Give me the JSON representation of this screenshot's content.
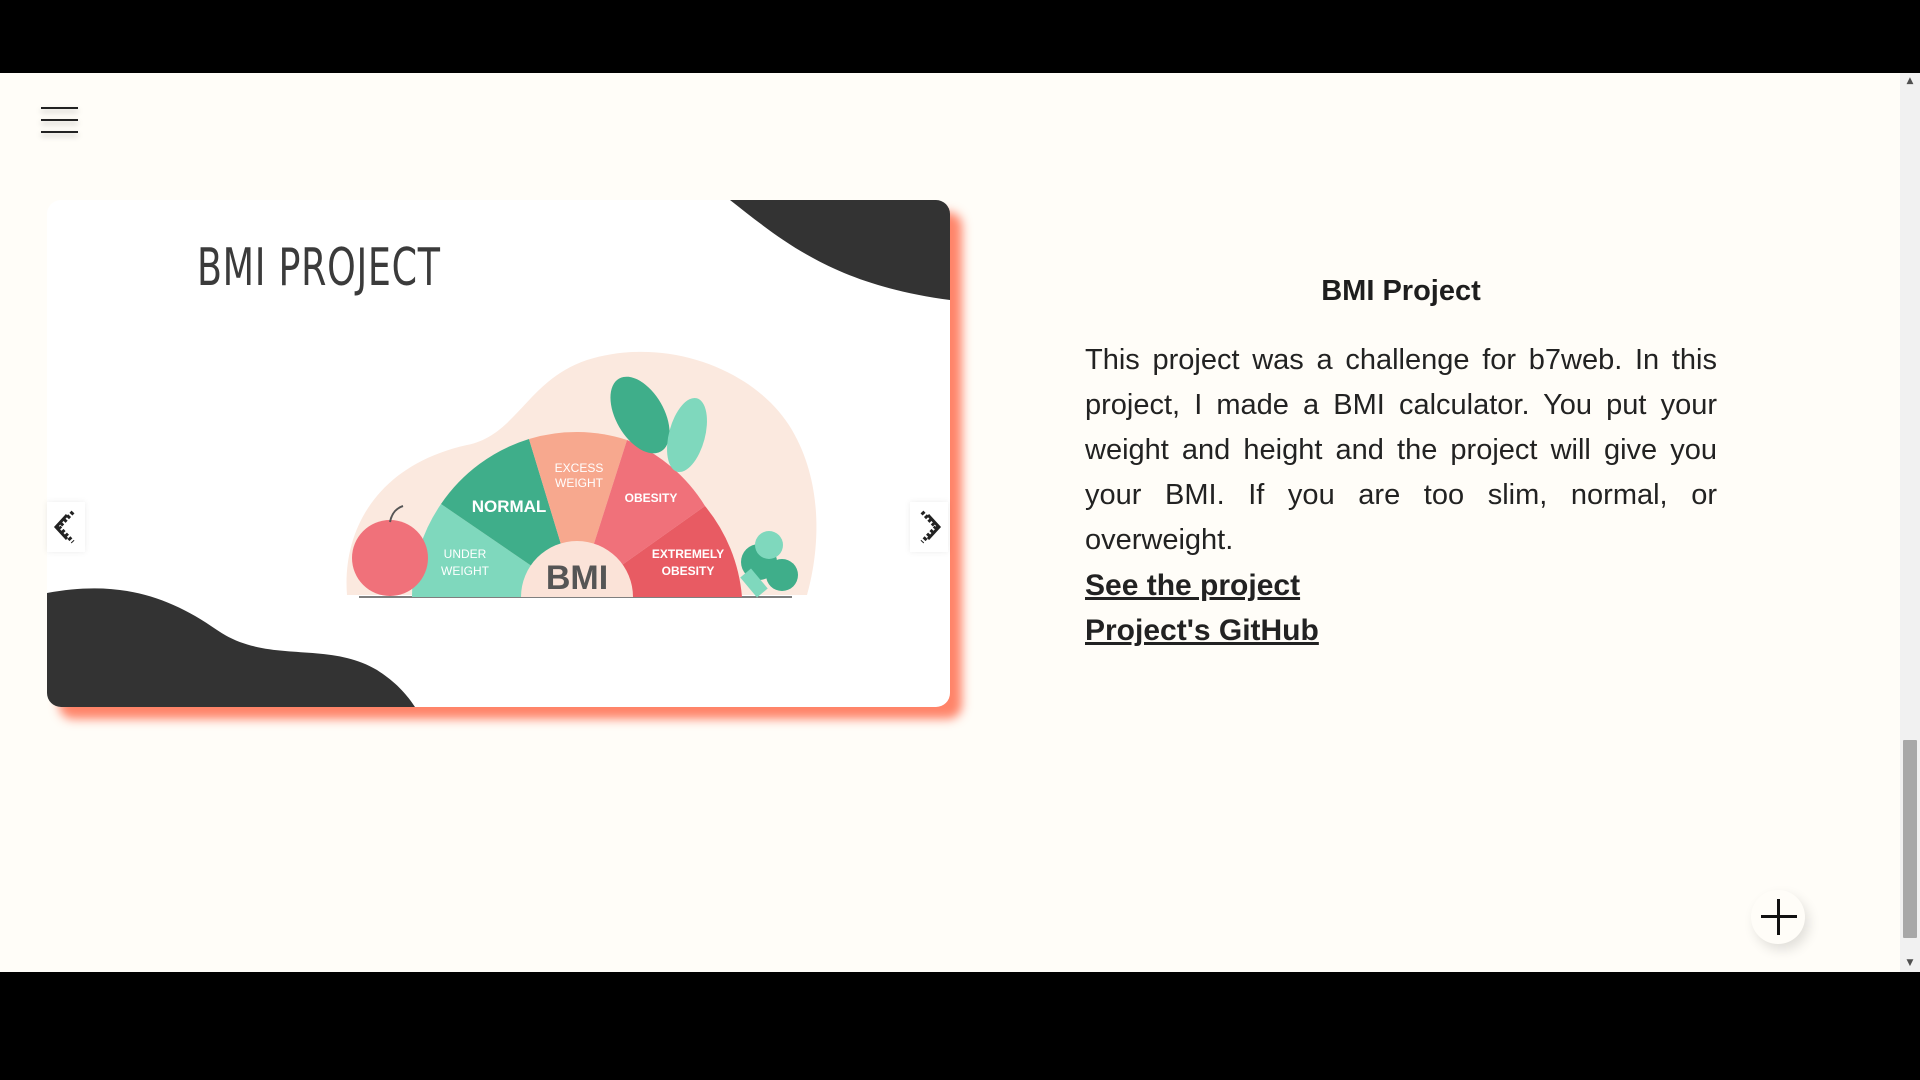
{
  "slider": {
    "slide_title": "BMI PROJECT",
    "illustration": {
      "labels": {
        "normal": "NORMAL",
        "excess_line1": "EXCESS",
        "excess_line2": "WEIGHT",
        "obesity": "OBESITY",
        "under_line1": "UNDER",
        "under_line2": "WEIGHT",
        "extreme_line1": "EXTREMELY",
        "extreme_line2": "OBESITY",
        "center": "BMI"
      },
      "colors": {
        "underweight": "#7fd8bd",
        "normal": "#3fae8a",
        "excess": "#f7a88e",
        "obesity": "#f0717a",
        "extreme": "#e85b63",
        "blob": "#fbe9df",
        "dark_shape": "#333333"
      }
    },
    "prev_icon": "chevron-left-icon",
    "next_icon": "chevron-right-icon"
  },
  "project": {
    "title": "BMI Project",
    "description": "This project was a challenge for b7web. In this project, I made a BMI calculator. You put your weight and height and the project will give you your BMI. If you are too slim, normal, or overweight.",
    "link_project": "See the project",
    "link_github": "Project's GitHub"
  },
  "accent_shadow_color": "#ff6e50"
}
